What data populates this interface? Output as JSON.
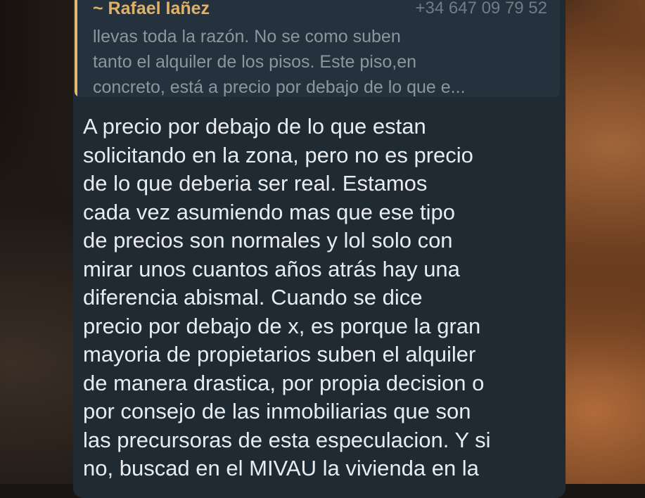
{
  "reply": {
    "sender": "~ Rafael Iañez",
    "phone": "+34 647 09 79 52",
    "lines": [
      "llevas toda la razón. No se como suben",
      "tanto el alquiler de los pisos. Este piso,en",
      "concreto, está a precio por debajo de lo que e..."
    ]
  },
  "message": {
    "lines": [
      "A precio por debajo de lo que estan",
      "solicitando en la zona, pero no es precio",
      "de lo que deberia ser real. Estamos",
      "cada vez asumiendo mas que ese tipo",
      "de precios son normales y lol solo con",
      "mirar unos cuantos años atrás hay una",
      "diferencia abismal. Cuando se dice",
      "precio por debajo de x, es porque la gran",
      "mayoria de propietarios suben el alquiler",
      "de manera drastica, por propia decision o",
      "por consejo de las inmobiliarias que son",
      "las precursoras de esta especulacion. Y si",
      "no, buscad en el MIVAU la vivienda en la"
    ]
  }
}
